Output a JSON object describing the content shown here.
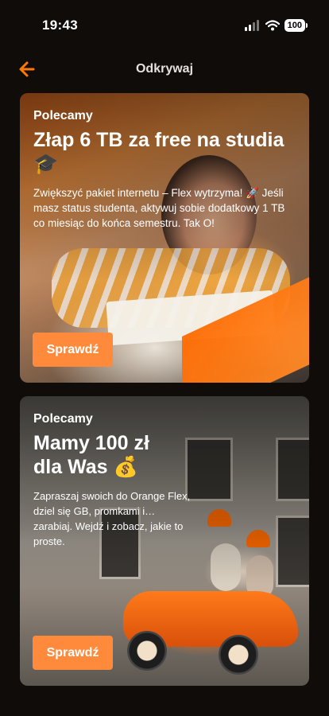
{
  "status_bar": {
    "time": "19:43",
    "battery": "100"
  },
  "nav": {
    "title": "Odkrywaj",
    "back_icon": "arrow-left-icon",
    "accent": "#ff7900"
  },
  "cards": [
    {
      "eyebrow": "Polecamy",
      "headline": "Złap 6 TB za free na studia 🎓",
      "description": "Zwiększyć pakiet internetu – Flex wytrzyma! 🚀 Jeśli masz status studenta, aktywuj sobie dodatkowy 1 TB co miesiąc do końca semestru. Tak O!",
      "cta": "Sprawdź"
    },
    {
      "eyebrow": "Polecamy",
      "headline_line1": "Mamy 100 zł",
      "headline_line2": "dla Was 💰",
      "description": "Zapraszaj swoich do Orange Flex, dziel się GB, promkami i… zarabiaj. Wejdź i zobacz, jakie to proste.",
      "cta": "Sprawdź"
    }
  ],
  "colors": {
    "background": "#0f0c0a",
    "cta": "#ff8a3c"
  }
}
